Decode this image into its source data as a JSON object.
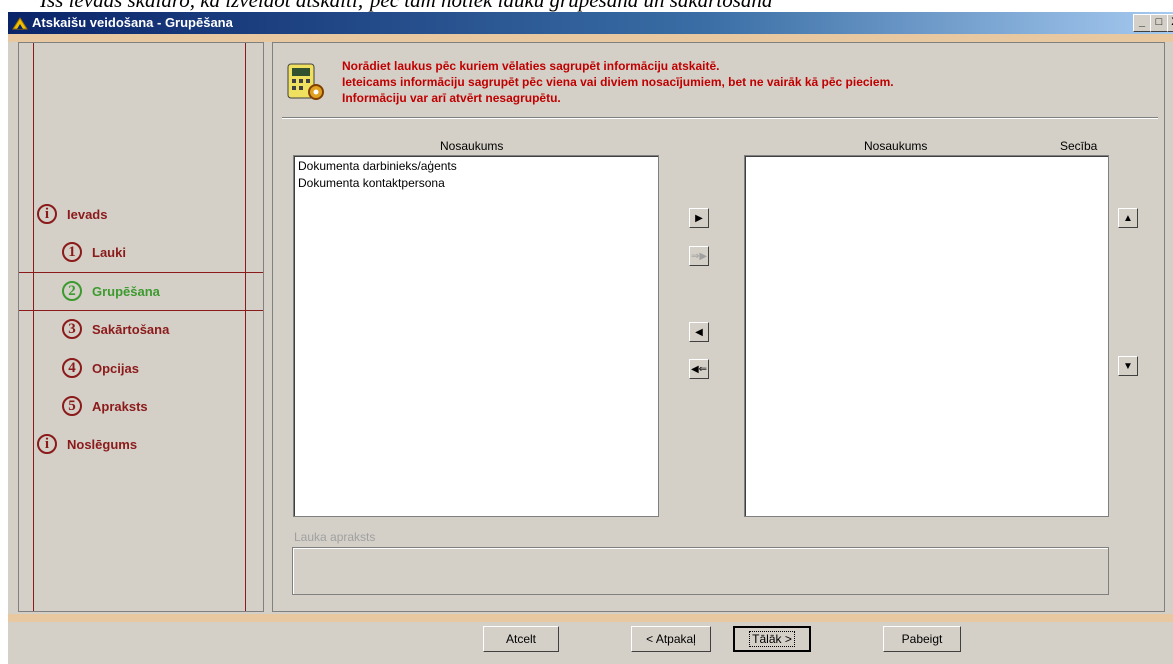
{
  "window": {
    "title": "Atskaišu veidošana - Grupēšana",
    "controls": [
      "_",
      "□",
      "X"
    ]
  },
  "sidebar": {
    "items": [
      {
        "symbol": "i",
        "label": "Ievads",
        "active": false
      },
      {
        "symbol": "1",
        "label": "Lauki",
        "active": false
      },
      {
        "symbol": "2",
        "label": "Grupēšana",
        "active": true
      },
      {
        "symbol": "3",
        "label": "Sakārtošana",
        "active": false
      },
      {
        "symbol": "4",
        "label": "Opcijas",
        "active": false
      },
      {
        "symbol": "5",
        "label": "Apraksts",
        "active": false
      },
      {
        "symbol": "i",
        "label": "Noslēgums",
        "active": false
      }
    ]
  },
  "info": {
    "lines": [
      "Norādiet laukus pēc kuriem vēlaties sagrupēt informāciju atskaitē.",
      "Ieteicams informāciju sagrupēt pēc viena vai diviem nosacījumiem, bet ne vairāk kā pēc pieciem.",
      "Informāciju var arī atvērt nesagrupētu."
    ]
  },
  "left_list": {
    "header": "Nosaukums",
    "items": [
      "Dokumenta darbinieks/aģents",
      "Dokumenta kontaktpersona"
    ]
  },
  "right_list": {
    "header_name": "Nosaukums",
    "header_order": "Secība",
    "items": []
  },
  "transfer_buttons": {
    "add": "▶",
    "add_all": "⇒▶",
    "remove": "◀",
    "remove_all": "◀⇐"
  },
  "order_buttons": {
    "up": "▲",
    "down": "▼"
  },
  "description": {
    "label": "Lauka apraksts",
    "value": ""
  },
  "footer": {
    "cancel": "Atcelt",
    "back": "< Atpakaļ",
    "next": "Tālāk >",
    "finish": "Pabeigt"
  },
  "colors": {
    "accent": "#8b1a1a",
    "active": "#3c9a2e",
    "info_text": "#c00000",
    "frame": "#e8c8a0"
  }
}
